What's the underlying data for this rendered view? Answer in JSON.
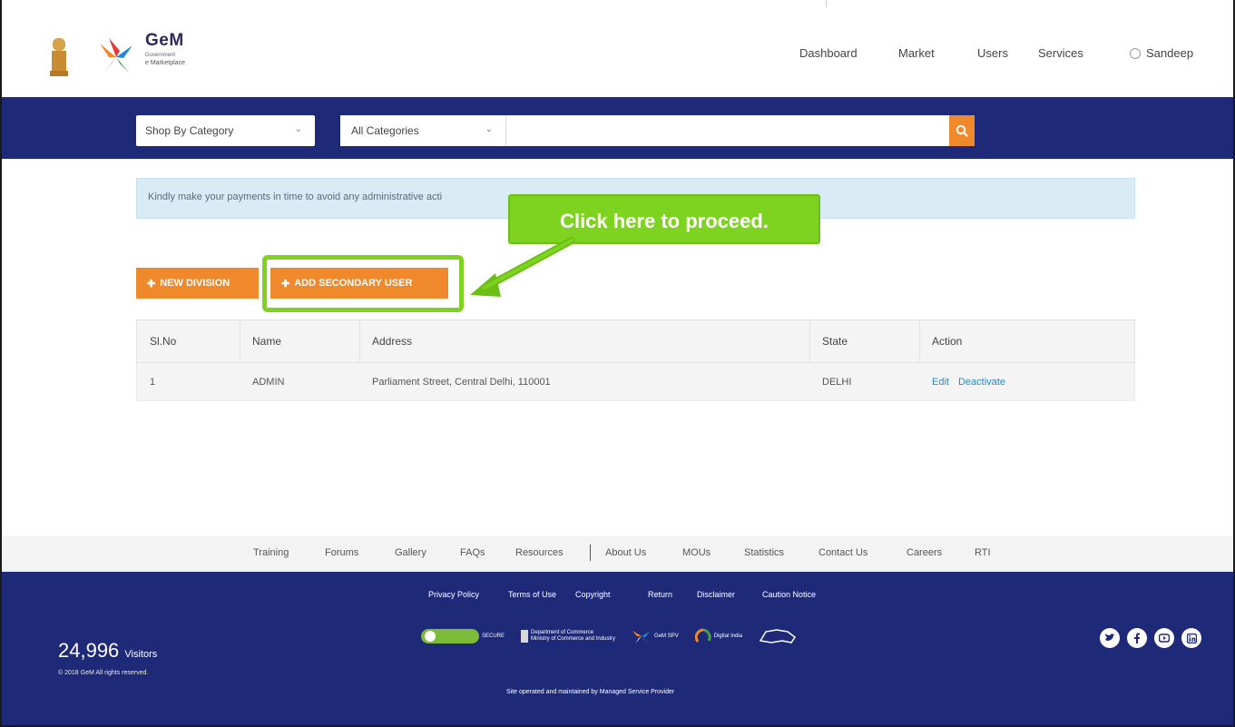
{
  "header": {
    "logo_title": "GeM",
    "logo_sub1": "Government",
    "logo_sub2": "e Marketplace",
    "nav": [
      "Dashboard",
      "Market",
      "Users",
      "Services"
    ],
    "user": "Sandeep"
  },
  "search": {
    "shop_by_category": "Shop By Category",
    "all_categories": "All Categories",
    "query": "",
    "chevron": "⌄"
  },
  "alert": {
    "text": "Kindly make your payments in time to avoid any administrative acti"
  },
  "callout": {
    "text": "Click here to proceed.",
    "color": "#7ed321"
  },
  "actions": {
    "new_division": "NEW DIVISION",
    "add_secondary_user": "ADD SECONDARY USER",
    "plus": "✚"
  },
  "table": {
    "headers": [
      "Sl.No",
      "Name",
      "Address",
      "State",
      "Action"
    ],
    "rows": [
      {
        "sl": "1",
        "name": "ADMIN",
        "address": "Parliament Street, Central Delhi, 110001",
        "state": "DELHI",
        "edit": "Edit",
        "deactivate": "Deactivate"
      }
    ]
  },
  "footer_links": [
    "Training",
    "Forums",
    "Gallery",
    "FAQs",
    "Resources",
    "About Us",
    "MOUs",
    "Statistics",
    "Contact Us",
    "Careers",
    "RTI"
  ],
  "footer": {
    "policy_links": [
      "Privacy Policy",
      "Terms of Use",
      "Copyright",
      "Return",
      "Disclaimer",
      "Caution Notice"
    ],
    "visitors_count": "24,996",
    "visitors_label": "Visitors",
    "rights": "© 2018 GeM All rights reserved.",
    "maintained": "Site operated and maintained by Managed Service Provider",
    "badge_secure": "SECURE",
    "badge_commerce1": "Department of Commerce",
    "badge_commerce2": "Ministry of Commerce and Industry",
    "badge_gem_spv": "GeM SPV",
    "badge_digital_india": "Digital India",
    "social_icons": [
      "twitter-icon",
      "facebook-icon",
      "youtube-icon",
      "linkedin-icon"
    ]
  },
  "colors": {
    "brand_blue": "#1e2a78",
    "accent_orange": "#f0892b",
    "link_blue": "#2a8ac4",
    "alert_bg": "#d9ecf6"
  }
}
